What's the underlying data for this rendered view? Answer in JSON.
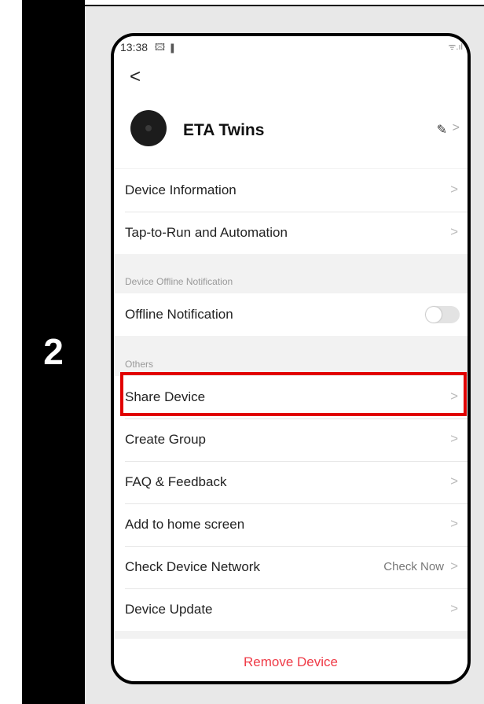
{
  "step": "2",
  "status": {
    "time": "13:38",
    "left_icons": "🖾 ▮",
    "right_icons": "ᯤ.ıl"
  },
  "nav": {
    "back": "<"
  },
  "device": {
    "name": "ETA Twins",
    "edit_icon": "✎",
    "chevron": ">"
  },
  "rows": [
    {
      "label": "Device Information",
      "chevron": ">"
    },
    {
      "label": "Tap-to-Run and Automation",
      "chevron": ">"
    },
    {
      "label": "Offline Notification"
    },
    {
      "label": "Share Device",
      "chevron": ">"
    },
    {
      "label": "Create Group",
      "chevron": ">"
    },
    {
      "label": "FAQ & Feedback",
      "chevron": ">"
    },
    {
      "label": "Add to home screen",
      "chevron": ">"
    },
    {
      "label": "Check Device Network",
      "extra": "Check Now",
      "chevron": ">"
    },
    {
      "label": "Device Update",
      "chevron": ">"
    }
  ],
  "sections": {
    "offline": "Device Offline Notification",
    "others": "Others"
  },
  "toggle": {
    "offline_notification_on": false
  },
  "remove": "Remove Device",
  "colors": {
    "highlight": "#e10000",
    "remove": "#ef3b47"
  }
}
